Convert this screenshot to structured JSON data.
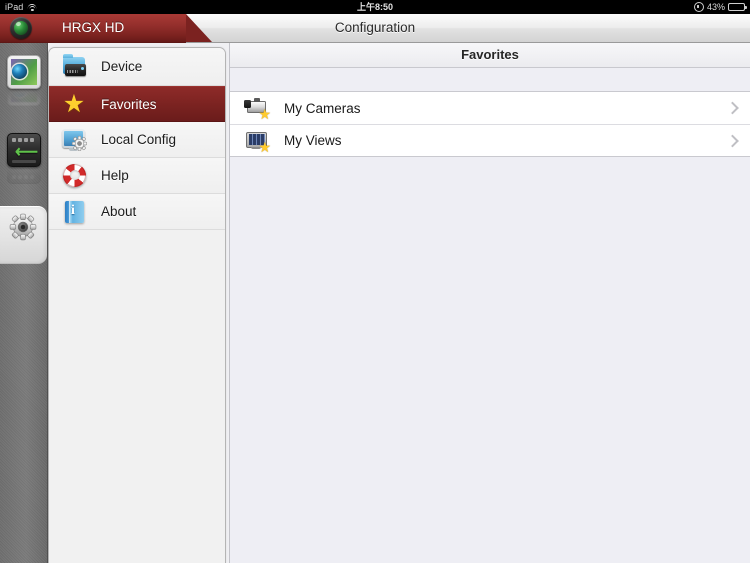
{
  "status_bar": {
    "carrier": "iPad",
    "wifi_icon": "wifi-icon",
    "time": "上午8:50",
    "lock_icon": "rotation-lock-icon",
    "battery_percent": "43%",
    "battery_level": 43
  },
  "navbar": {
    "app_logo_icon": "camera-lens-logo-icon",
    "app_name": "HRGX HD",
    "title": "Configuration"
  },
  "dock": {
    "items": [
      {
        "name": "live-view",
        "icon": "live-view-icon",
        "selected": false
      },
      {
        "name": "playback",
        "icon": "playback-icon",
        "selected": false
      },
      {
        "name": "configuration",
        "icon": "gear-icon",
        "selected": true
      }
    ]
  },
  "menu": {
    "items": [
      {
        "label": "Device",
        "icon": "device-folder-icon",
        "active": false
      },
      {
        "label": "Favorites",
        "icon": "star-icon",
        "active": true
      },
      {
        "label": "Local Config",
        "icon": "monitor-gear-icon",
        "active": false
      },
      {
        "label": "Help",
        "icon": "lifebuoy-icon",
        "active": false
      },
      {
        "label": "About",
        "icon": "info-book-icon",
        "active": false
      }
    ]
  },
  "content": {
    "header": "Favorites",
    "rows": [
      {
        "label": "My Cameras",
        "icon": "camera-star-icon",
        "chevron": "chevron-right-icon"
      },
      {
        "label": "My Views",
        "icon": "multiview-star-icon",
        "chevron": "chevron-right-icon"
      }
    ]
  },
  "colors": {
    "accent_red": "#7c2321",
    "tab_red": "#942f2c",
    "star_yellow": "#ffd02e",
    "panel_bg": "#eeeef4",
    "dock_gray": "#7b7b7b"
  }
}
